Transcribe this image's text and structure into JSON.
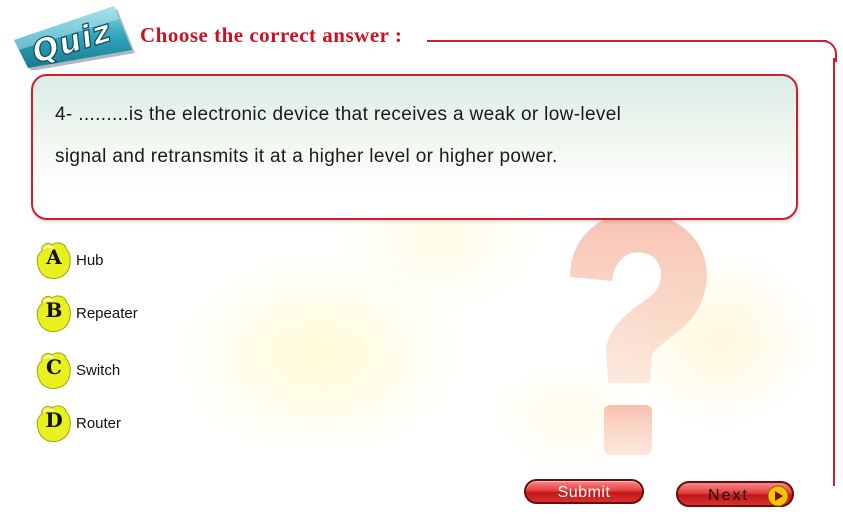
{
  "logo": {
    "text": "Quiz"
  },
  "heading": "Choose the correct answer :",
  "question": {
    "line1": "4- .........is the electronic device that receives a weak or low-level",
    "line2": "signal and retransmits it at a higher level or higher power."
  },
  "options": [
    {
      "letter": "A",
      "label": "Hub"
    },
    {
      "letter": "B",
      "label": "Repeater"
    },
    {
      "letter": "C",
      "label": "Switch"
    },
    {
      "letter": "D",
      "label": "Router"
    }
  ],
  "buttons": {
    "submit": "Submit",
    "next": "Next"
  },
  "colors": {
    "accent": "#cc1122",
    "badge": "#e8f020",
    "button": "#d82a2a"
  },
  "icons": {
    "next": "play-arrow-icon",
    "background": "question-mark-icon"
  }
}
